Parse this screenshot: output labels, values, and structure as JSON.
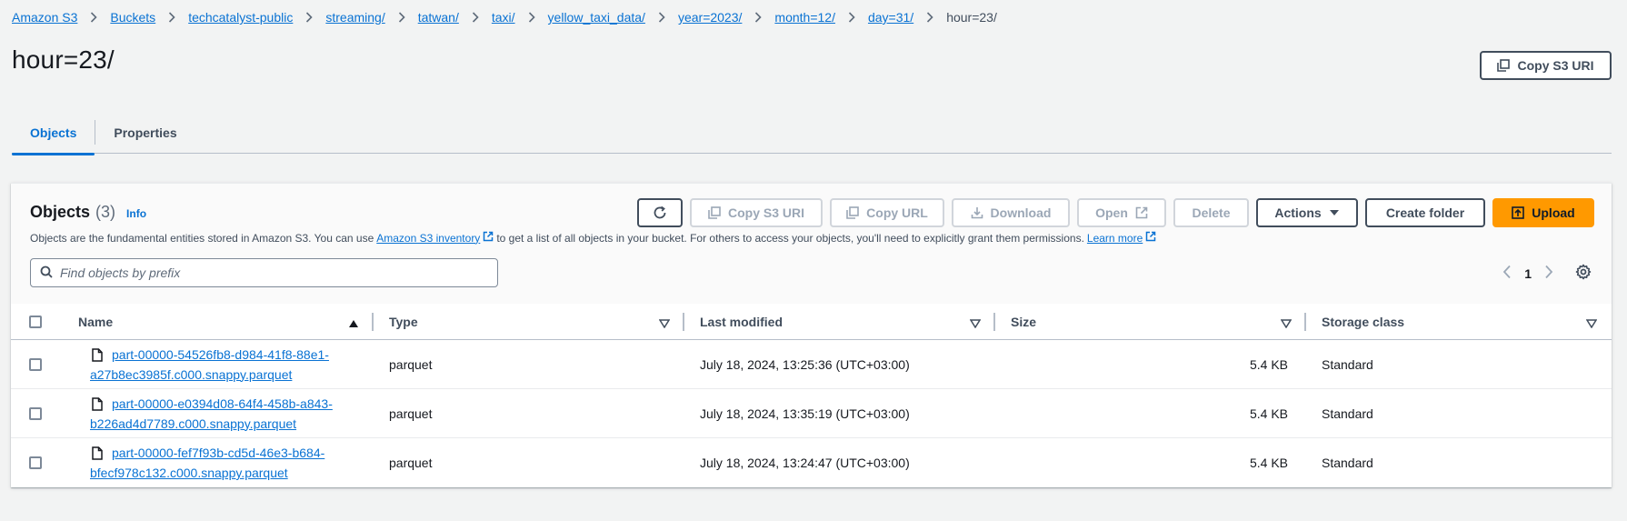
{
  "breadcrumb": [
    {
      "label": "Amazon S3"
    },
    {
      "label": "Buckets"
    },
    {
      "label": "techcatalyst-public"
    },
    {
      "label": "streaming/"
    },
    {
      "label": "tatwan/"
    },
    {
      "label": "taxi/"
    },
    {
      "label": "yellow_taxi_data/"
    },
    {
      "label": "year=2023/"
    },
    {
      "label": "month=12/"
    },
    {
      "label": "day=31/"
    }
  ],
  "breadcrumb_current": "hour=23/",
  "page_title": "hour=23/",
  "header_copy_uri": "Copy S3 URI",
  "tabs": [
    {
      "label": "Objects",
      "active": true
    },
    {
      "label": "Properties",
      "active": false
    }
  ],
  "objects": {
    "title": "Objects",
    "count": "(3)",
    "info": "Info",
    "desc_1": "Objects are the fundamental entities stored in Amazon S3. You can use",
    "desc_link_1": "Amazon S3 inventory",
    "desc_2": "to get a list of all objects in your bucket. For others to access your objects, you'll need to explicitly grant them permissions.",
    "desc_link_2": "Learn more",
    "actions": {
      "copy_s3_uri": "Copy S3 URI",
      "copy_url": "Copy URL",
      "download": "Download",
      "open": "Open",
      "delete": "Delete",
      "actions": "Actions",
      "create_folder": "Create folder",
      "upload": "Upload"
    },
    "search_placeholder": "Find objects by prefix",
    "page": "1",
    "columns": {
      "name": "Name",
      "type": "Type",
      "last_modified": "Last modified",
      "size": "Size",
      "storage_class": "Storage class"
    },
    "rows": [
      {
        "name_1": "part-00000-54526fb8-d984-41f8-88e1-",
        "name_2": "a27b8ec3985f.c000.snappy.parquet",
        "type": "parquet",
        "last_modified": "July 18, 2024, 13:25:36 (UTC+03:00)",
        "size": "5.4 KB",
        "storage_class": "Standard"
      },
      {
        "name_1": "part-00000-e0394d08-64f4-458b-a843-",
        "name_2": "b226ad4d7789.c000.snappy.parquet",
        "type": "parquet",
        "last_modified": "July 18, 2024, 13:35:19 (UTC+03:00)",
        "size": "5.4 KB",
        "storage_class": "Standard"
      },
      {
        "name_1": "part-00000-fef7f93b-cd5d-46e3-b684-",
        "name_2": "bfecf978c132.c000.snappy.parquet",
        "type": "parquet",
        "last_modified": "July 18, 2024, 13:24:47 (UTC+03:00)",
        "size": "5.4 KB",
        "storage_class": "Standard"
      }
    ]
  },
  "colors": {
    "link": "#0972d3",
    "primary": "#ff9900",
    "text": "#16191f",
    "background": "#f2f3f3"
  }
}
